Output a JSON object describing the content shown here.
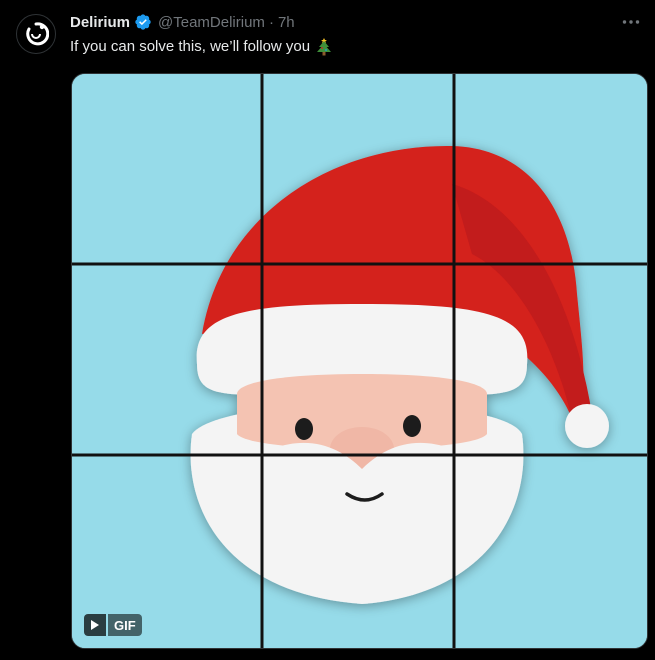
{
  "tweet": {
    "author": {
      "display_name": "Delirium",
      "handle": "@TeamDelirium",
      "separator": "·",
      "time": "7h",
      "verified": true,
      "avatar_icon": "delirium-logo-icon"
    },
    "text": "If you can solve this, we’ll follow you",
    "emoji_icon": "christmas-tree-icon",
    "more_icon": "more-options-icon",
    "media": {
      "type": "gif",
      "badge_label": "GIF",
      "play_icon": "play-icon",
      "content": "santa-puzzle-3x3",
      "background_color": "#96dbe9",
      "grid_color": "#111111"
    },
    "colors": {
      "background": "#000000",
      "text": "#e7e9ea",
      "muted": "#71767b",
      "verified": "#1d9bf0",
      "hat_red": "#d4201e",
      "beard_white": "#f4f4f4",
      "skin": "#f4c3b2"
    }
  }
}
